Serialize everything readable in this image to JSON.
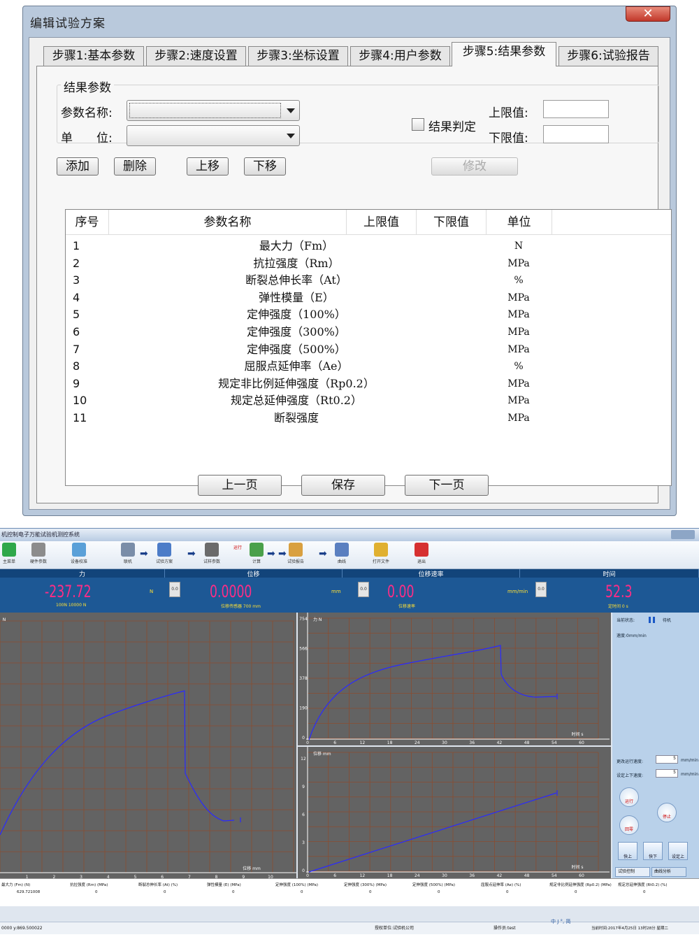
{
  "dialog": {
    "title": "编辑试验方案",
    "close_label": "✕",
    "tabs": [
      "步骤1:基本参数",
      "步骤2:速度设置",
      "步骤3:坐标设置",
      "步骤4:用户参数",
      "步骤5:结果参数",
      "步骤6:试验报告"
    ],
    "active_tab": 4,
    "group_title": "结果参数",
    "param_name_label": "参数名称:",
    "unit_label": "单　　位:",
    "result_judge_label": "结果判定",
    "upper_label": "上限值:",
    "lower_label": "下限值:",
    "add": "添加",
    "delete": "删除",
    "move_up": "上移",
    "move_down": "下移",
    "modify": "修改",
    "columns": [
      "序号",
      "参数名称",
      "上限值",
      "下限值",
      "单位"
    ],
    "rows": [
      {
        "no": "1",
        "name": "最大力（Fm）",
        "unit": "N"
      },
      {
        "no": "2",
        "name": "抗拉强度（Rm）",
        "unit": "MPa"
      },
      {
        "no": "3",
        "name": "断裂总伸长率（At）",
        "unit": "%"
      },
      {
        "no": "4",
        "name": "弹性模量（E）",
        "unit": "MPa"
      },
      {
        "no": "5",
        "name": "定伸强度（100%）",
        "unit": "MPa"
      },
      {
        "no": "6",
        "name": "定伸强度（300%）",
        "unit": "MPa"
      },
      {
        "no": "7",
        "name": "定伸强度（500%）",
        "unit": "MPa"
      },
      {
        "no": "8",
        "name": "屈服点延伸率（Ae）",
        "unit": "%"
      },
      {
        "no": "9",
        "name": "规定非比例延伸强度（Rp0.2）",
        "unit": "MPa"
      },
      {
        "no": "10",
        "name": "规定总延伸强度（Rt0.2）",
        "unit": "MPa"
      },
      {
        "no": "11",
        "name": "断裂强度",
        "unit": "MPa"
      }
    ],
    "prev_page": "上一页",
    "save": "保存",
    "next_page": "下一页"
  },
  "app": {
    "title": "机控制电子万能试验机测控系统",
    "toolbar": [
      {
        "label": "主菜单",
        "icon": "menu-icon",
        "color": "#2fa84a"
      },
      {
        "label": "硬件参数",
        "icon": "gear-icon",
        "color": "#8c8c8c"
      },
      {
        "label": "设备校准",
        "icon": "calibrate-icon",
        "color": "#5aa0d8"
      },
      {
        "label": "联机",
        "icon": "link-icon",
        "color": "#7a8da8"
      },
      {
        "label": "试验方案",
        "icon": "scheme-icon",
        "color": "#4c7cc8"
      },
      {
        "label": "试样参数",
        "icon": "sample-icon",
        "color": "#6b6b6b"
      },
      {
        "label": "计算",
        "icon": "calc-icon",
        "color": "#4aa04a"
      },
      {
        "label": "试验报告",
        "icon": "report-icon",
        "color": "#d9a040"
      },
      {
        "label": "曲线",
        "icon": "curve-icon",
        "color": "#5a7fc0"
      },
      {
        "label": "打开文件",
        "icon": "folder-icon",
        "color": "#e0b030"
      },
      {
        "label": "退出",
        "icon": "exit-icon",
        "color": "#d63030"
      }
    ],
    "run_label": "运行",
    "meters": [
      {
        "header": "力",
        "value": "-237.72",
        "unit": "N",
        "sub": "100N 10000 N",
        "btn": "0.0"
      },
      {
        "header": "位移",
        "value": "0.0000",
        "unit": "mm",
        "sub": "位移传感器 700 mm",
        "btn": "0.0"
      },
      {
        "header": "位移速率",
        "value": "0.00",
        "unit": "mm/min",
        "sub": "位移速率",
        "btn": "0.0"
      },
      {
        "header": "时间",
        "value": "52.3",
        "unit": "",
        "sub": "定时间  0 s",
        "btn": ""
      }
    ],
    "plot_large": {
      "xlabel": "位移 mm",
      "ylabel": "N",
      "xticks": [
        "",
        "1",
        "2",
        "3",
        "4",
        "5",
        "6",
        "7",
        "8",
        "9",
        "10"
      ]
    },
    "plot_force": {
      "ylabel": "力 N",
      "xlabel": "时间 s",
      "yticks": [
        "0",
        "190",
        "378",
        "566",
        "754"
      ],
      "xticks": [
        "0",
        "6",
        "12",
        "18",
        "24",
        "30",
        "36",
        "42",
        "48",
        "54",
        "60"
      ]
    },
    "plot_disp": {
      "ylabel": "位移 mm",
      "xlabel": "时间 s",
      "yticks": [
        "0",
        "3",
        "6",
        "9",
        "12"
      ],
      "xticks": [
        "0",
        "6",
        "12",
        "18",
        "24",
        "30",
        "36",
        "42",
        "48",
        "54",
        "60"
      ]
    },
    "side": {
      "state_label": "当前状态:",
      "state_value": "待机",
      "speed_label": "速度:0mm/min",
      "run_speed_label": "更改运行速度:",
      "run_speed_value": "5",
      "run_speed_unit": "mm/min",
      "updown_label": "设定上下速度:",
      "updown_value": "5",
      "updown_unit": "mm/min",
      "run": "运行",
      "stop": "停止",
      "return": "回零",
      "fast_up": "快上",
      "fast_down": "快下",
      "set_up": "设定上",
      "tab1": "试验控制",
      "tab2": "曲线分析"
    },
    "results_cols": [
      "最大力 (Fm) (N)",
      "抗拉强度 (Rm) (MPa)",
      "断裂总伸长率 (At) (%)",
      "弹性模量 (E) (MPa)",
      "定伸强度 (100%) (MPa)",
      "定伸强度 (300%) (MPa)",
      "定伸强度 (500%) (MPa)",
      "屈服点延伸率 (Ae) (%)",
      "规定非比例延伸强度 (Rp0.2) (MPa)",
      "规定总延伸强度 (Rt0.2) (%)"
    ],
    "results_vals": [
      "629.721008",
      "0",
      "0",
      "0",
      "0",
      "0",
      "0",
      "0",
      "0",
      "0"
    ],
    "status_left": "0000 y:869.500022",
    "status_company": "授权单位:试验机公司",
    "status_operator": "操作员:test",
    "status_time": "当前时间:2017年4月25日 13时28分 星期二",
    "ime": "中 J °, 简"
  }
}
